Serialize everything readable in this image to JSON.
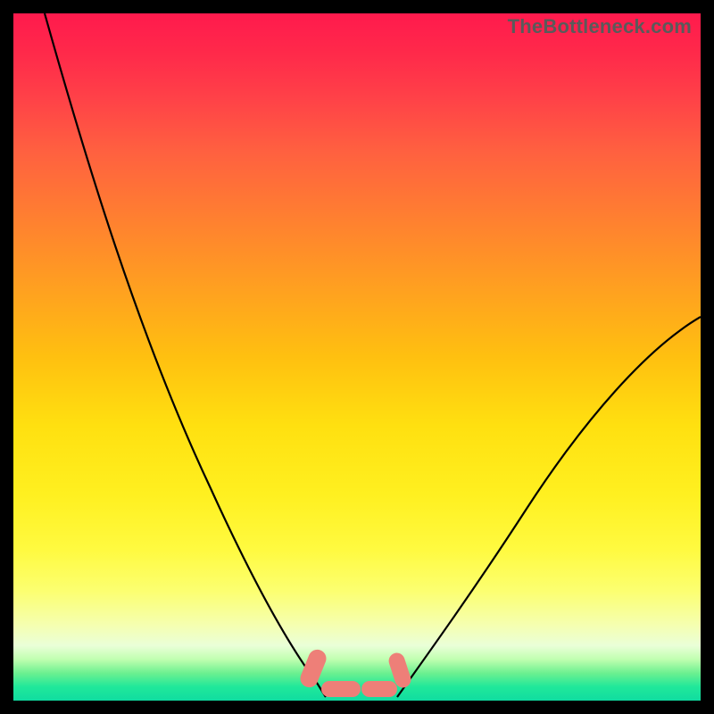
{
  "watermark": "TheBottleneck.com",
  "chart_data": {
    "type": "line",
    "title": "",
    "xlabel": "",
    "ylabel": "",
    "xlim": [
      0,
      100
    ],
    "ylim": [
      0,
      100
    ],
    "grid": false,
    "legend": false,
    "background_gradient": {
      "top": "#ff1a4d",
      "mid": "#ffe010",
      "bottom": "#10dca0"
    },
    "series": [
      {
        "name": "left-curve",
        "x": [
          4,
          8,
          12,
          16,
          20,
          24,
          28,
          32,
          36,
          40,
          43,
          45
        ],
        "y": [
          100,
          88,
          76,
          65,
          54,
          44,
          34,
          25,
          17,
          10,
          5,
          2
        ]
      },
      {
        "name": "right-curve",
        "x": [
          56,
          60,
          64,
          68,
          72,
          76,
          80,
          84,
          88,
          92,
          96,
          100
        ],
        "y": [
          2,
          5,
          9,
          14,
          20,
          26,
          33,
          40,
          47,
          55,
          55,
          55
        ]
      }
    ],
    "annotations": [
      {
        "name": "bottom-lobes",
        "color": "#ee7f78",
        "shape": "rounded-caps",
        "count": 4
      }
    ]
  }
}
